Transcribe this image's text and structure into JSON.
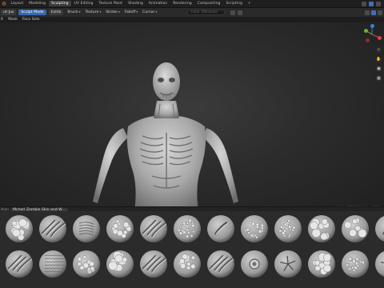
{
  "app": {
    "workspaces": [
      "Layout",
      "Modeling",
      "Sculpting",
      "UV Editing",
      "Texture Paint",
      "Shading",
      "Animation",
      "Rendering",
      "Compositing",
      "Scripting"
    ],
    "active_workspace": "Sculpting",
    "add_workspace_label": "+"
  },
  "header": {
    "mode_label": "ut-Jus",
    "object_mode_select": "Sculpt Mode",
    "brush_label": "Exhib",
    "menus": [
      "Brush",
      "Texture",
      "Stroke",
      "Falloff",
      "Cursor"
    ],
    "search_placeholder": "Color Attribute",
    "icons": [
      "sculpt-brush-icon",
      "viewport-shading-icon"
    ]
  },
  "menu_row": {
    "items": [
      "lt",
      "Mask",
      "Face Sets"
    ]
  },
  "viewport": {
    "subject": "zombie sculpt",
    "stats_text": "ert Verts 7,211,316 | Faces 7,211"
  },
  "nav_gizmo": {
    "axes": [
      {
        "label": "Z",
        "color": "#3b7ddb"
      },
      {
        "label": "X",
        "color": "#d9404a"
      },
      {
        "label": "Y",
        "color": "#70b13a"
      }
    ]
  },
  "viewport_tools": [
    "zoom-icon",
    "pan-icon",
    "camera-icon",
    "grid-icon"
  ],
  "brush_panel": {
    "header_label": "ition",
    "tab_label": "Mcharl Zombie Skin and W...",
    "thumbnails": [
      {
        "name": "brush-01",
        "pattern": "blobs"
      },
      {
        "name": "brush-02",
        "pattern": "slashes"
      },
      {
        "name": "brush-03",
        "pattern": "wrinkles"
      },
      {
        "name": "brush-04",
        "pattern": "bumps"
      },
      {
        "name": "brush-05",
        "pattern": "slashes"
      },
      {
        "name": "brush-06",
        "pattern": "pores"
      },
      {
        "name": "brush-07",
        "pattern": "scar"
      },
      {
        "name": "brush-08",
        "pattern": "pores"
      },
      {
        "name": "brush-09",
        "pattern": "pores"
      },
      {
        "name": "brush-10",
        "pattern": "blobs"
      },
      {
        "name": "brush-11",
        "pattern": "blobs"
      },
      {
        "name": "brush-12",
        "pattern": "scar"
      },
      {
        "name": "brush-13",
        "pattern": "slashes"
      },
      {
        "name": "brush-14",
        "pattern": "scales"
      },
      {
        "name": "brush-15",
        "pattern": "bumps"
      },
      {
        "name": "brush-16",
        "pattern": "blobs"
      },
      {
        "name": "brush-17",
        "pattern": "slashes"
      },
      {
        "name": "brush-18",
        "pattern": "bumps"
      },
      {
        "name": "brush-19",
        "pattern": "slashes"
      },
      {
        "name": "brush-20",
        "pattern": "ring"
      },
      {
        "name": "brush-21",
        "pattern": "star"
      },
      {
        "name": "brush-22",
        "pattern": "blobs"
      },
      {
        "name": "brush-23",
        "pattern": "pores"
      },
      {
        "name": "brush-24",
        "pattern": "star"
      }
    ]
  }
}
